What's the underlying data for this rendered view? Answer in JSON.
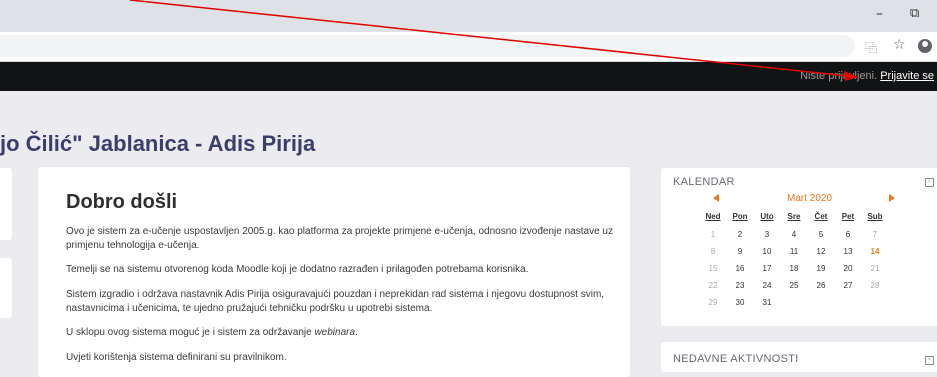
{
  "window": {
    "minimize_glyph": "–",
    "maximize_glyph": "⧉"
  },
  "browser": {
    "translate_glyph": "⿻",
    "star_glyph": "☆"
  },
  "navbar": {
    "status_text": "Niste prijavljeni.",
    "login_link": "Prijavite se"
  },
  "page": {
    "heading": "jo Čilić\" Jablanica - Adis Pirija"
  },
  "main": {
    "title": "Dobro došli",
    "p1": "Ovo je sistem za e-učenje uspostavljen 2005.g. kao platforma za projekte primjene e-učenja, odnosno izvođenje nastave uz primjenu tehnologija e-učenja.",
    "p2": "Temelji se na sistemu otvorenog koda Moodle koji je dodatno razrađen i prilagođen potrebama korisnika.",
    "p3": "Sistem izgradio i održava nastavnik Adis Pirija osiguravajući pouzdan i neprekidan rad sistema i njegovu dostupnost svim, nastavnicima i učenicima, te ujedno pružajući tehničku podršku u upotrebi sistema.",
    "p4_before": "U sklopu ovog sistema moguć je i sistem za održavanje ",
    "p4_italic": "webinara",
    "p4_after": ".",
    "p5": "Uvjeti korištenja sistema definirani su pravilnikom."
  },
  "calendar": {
    "title": "KALENDAR",
    "month": "Mart 2020",
    "collapse_glyph": "▫",
    "days": [
      "Ned",
      "Pon",
      "Uto",
      "Sre",
      "Čet",
      "Pet",
      "Sub"
    ],
    "weeks": [
      [
        "1",
        "2",
        "3",
        "4",
        "5",
        "6",
        "7"
      ],
      [
        "8",
        "9",
        "10",
        "11",
        "12",
        "13",
        "14"
      ],
      [
        "15",
        "16",
        "17",
        "18",
        "19",
        "20",
        "21"
      ],
      [
        "22",
        "23",
        "24",
        "25",
        "26",
        "27",
        "28"
      ],
      [
        "29",
        "30",
        "31",
        "",
        "",
        "",
        ""
      ]
    ],
    "today": "14",
    "accent_color": "#e8791c"
  },
  "recent": {
    "title": "NEDAVNE AKTIVNOSTI"
  },
  "annotation": {
    "color": "#e00000"
  }
}
